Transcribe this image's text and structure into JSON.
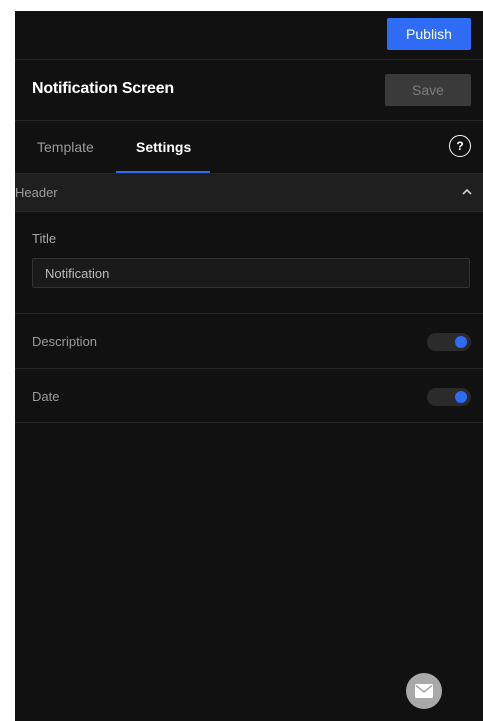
{
  "topbar": {
    "publish_label": "Publish"
  },
  "titlebar": {
    "title": "Notification Screen",
    "save_label": "Save"
  },
  "tabs": [
    {
      "label": "Template",
      "active": false
    },
    {
      "label": "Settings",
      "active": true
    }
  ],
  "help_icon": {
    "glyph": "?",
    "icon": "help-circle-icon"
  },
  "section": {
    "label": "Header",
    "expanded": true,
    "icon": "chevron-up-icon"
  },
  "fields": {
    "title_label": "Title",
    "title_value": "Notification"
  },
  "toggles": [
    {
      "label": "Description",
      "on": true
    },
    {
      "label": "Date",
      "on": true
    }
  ],
  "fab": {
    "icon": "envelope-icon"
  },
  "colors": {
    "accent": "#2f6cf6",
    "panel_bg": "#111111"
  }
}
